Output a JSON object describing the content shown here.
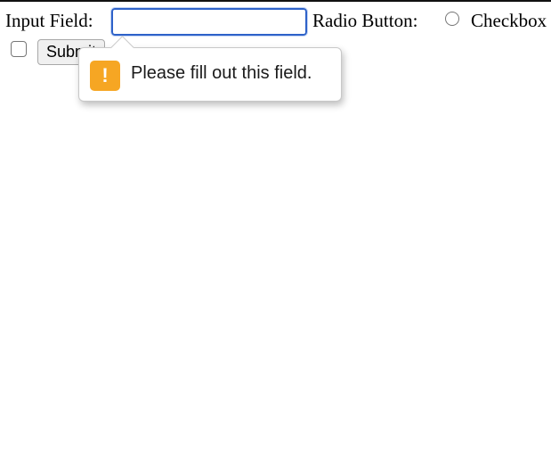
{
  "form": {
    "input_label": "Input Field:",
    "input_value": "",
    "radio_label": "Radio Button:",
    "checkbox_label": "Checkbox",
    "submit_label": "Submit"
  },
  "validation_popup": {
    "message": "Please fill out this field.",
    "icon": "warning-icon",
    "icon_glyph": "!",
    "icon_color": "#f6a623"
  },
  "colors": {
    "focus_ring": "#2e62c9"
  }
}
